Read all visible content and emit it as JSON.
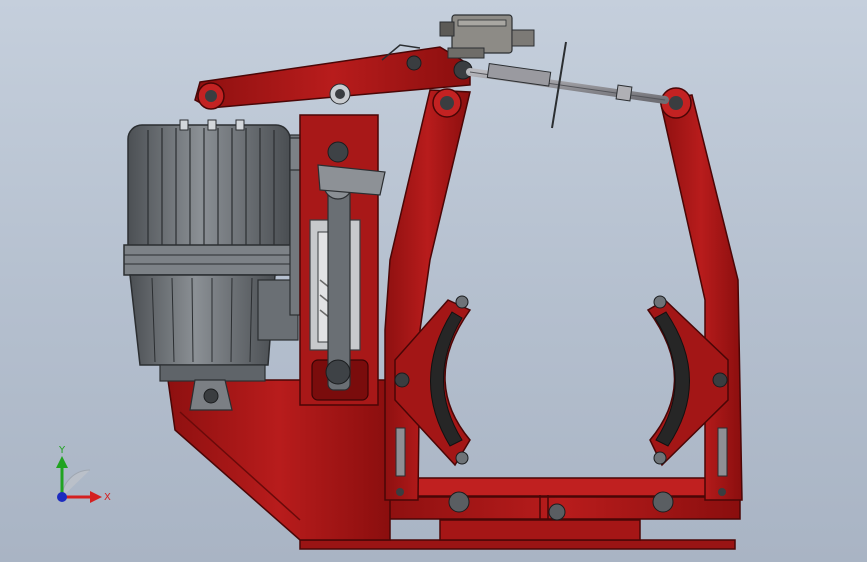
{
  "triad": {
    "y_label": "Y",
    "x_label": "X",
    "y_color": "#21a321",
    "x_color": "#d42020",
    "origin_color": "#1c2bbf"
  },
  "colors": {
    "background": "#b9c3d1",
    "frame_red": "#b01818",
    "frame_red_dark": "#7a0c0c",
    "motor_gray": "#6e7378",
    "motor_dark": "#3e4246",
    "brake_lining": "#2a2a2a",
    "rod_gray": "#8f8f94"
  },
  "parts": [
    "motor-thruster",
    "base-bracket",
    "lever-arm",
    "left-brake-arm",
    "right-brake-arm",
    "left-brake-shoe",
    "right-brake-shoe",
    "spring-guide",
    "tie-rod",
    "limit-switch",
    "bottom-base"
  ]
}
